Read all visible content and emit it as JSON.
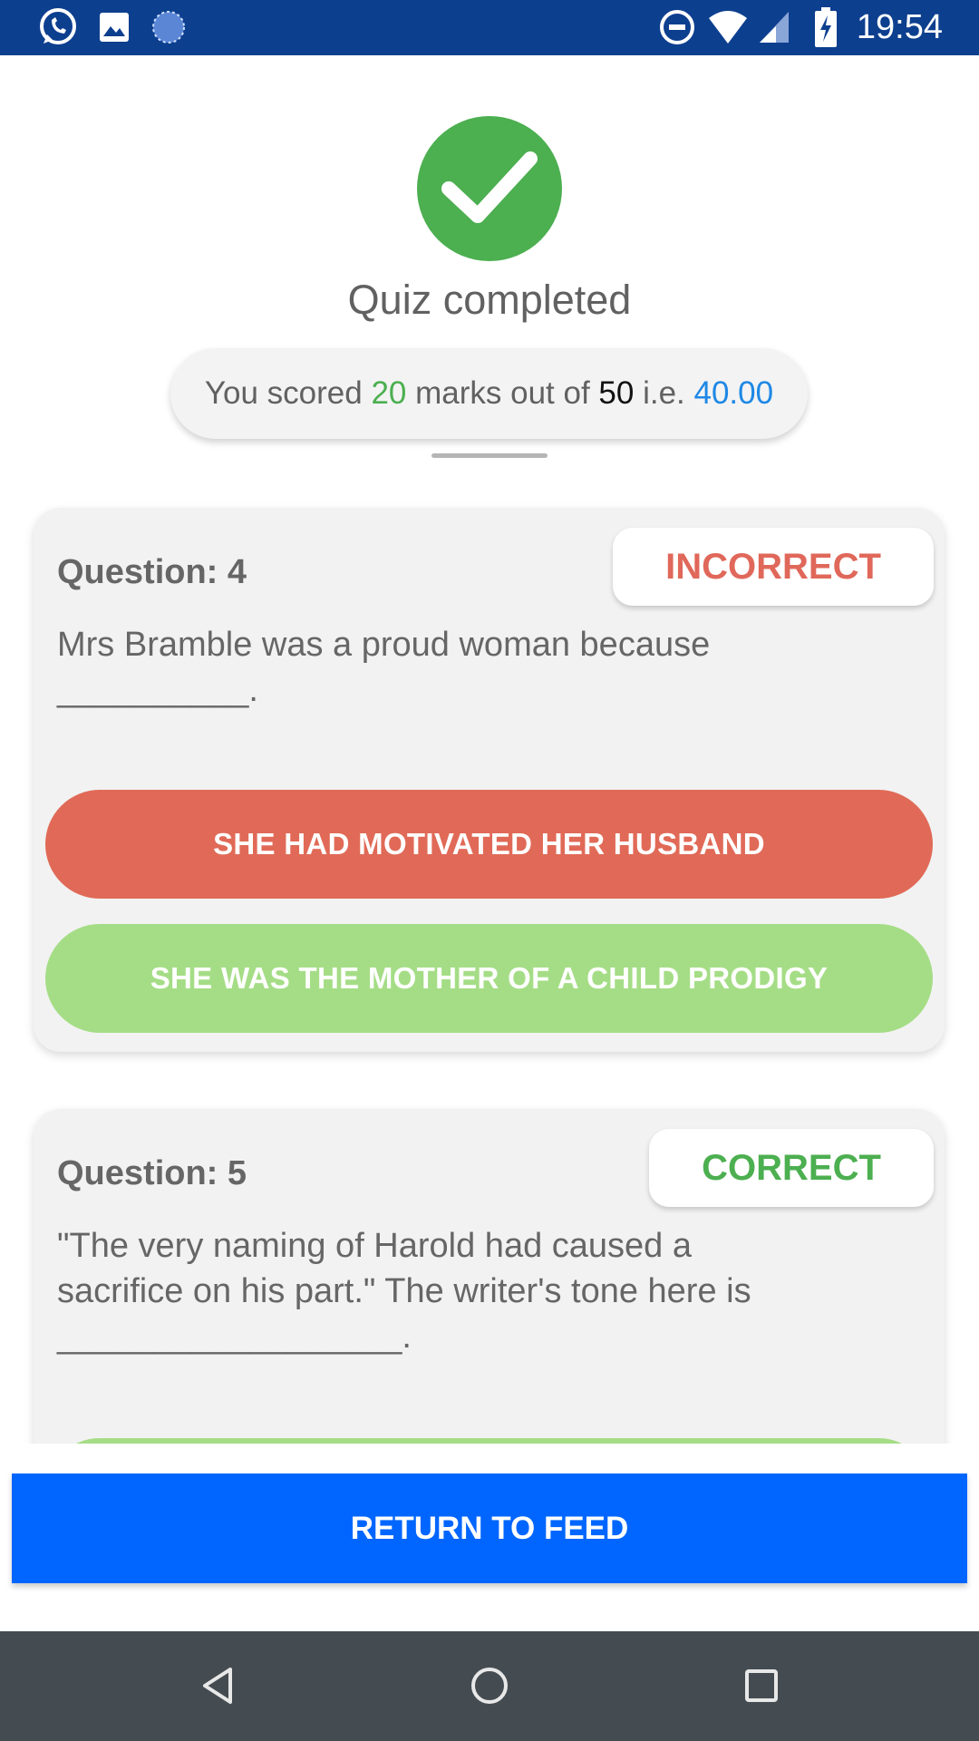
{
  "status_bar": {
    "time": "19:54",
    "left_icons": [
      "whatsapp-icon",
      "gallery-icon",
      "sync-icon"
    ],
    "right_icons": [
      "do-not-disturb-icon",
      "wifi-icon",
      "signal-icon",
      "battery-charging-icon"
    ]
  },
  "header": {
    "title": "Quiz completed",
    "score": {
      "prefix": "You scored ",
      "scored": "20",
      "middle": " marks out of ",
      "total": "50",
      "ie": " i.e. ",
      "percent": "40.00"
    }
  },
  "questions": [
    {
      "label": "Question: 4",
      "status": "INCORRECT",
      "text_line1": "Mrs Bramble was a proud woman because",
      "text_line2": "__________.",
      "answers": [
        {
          "label": "SHE HAD MOTIVATED HER HUSBAND",
          "state": "wrong"
        },
        {
          "label": "SHE WAS THE MOTHER OF A CHILD PRODIGY",
          "state": "right"
        }
      ]
    },
    {
      "label": "Question: 5",
      "status": "CORRECT",
      "text_line1": "\"The very naming of Harold had caused a",
      "text_line2": "sacrifice on his part.\" The writer's tone here is",
      "text_line3": "__________________."
    }
  ],
  "footer": {
    "return_label": "RETURN TO FEED"
  },
  "colors": {
    "status_bar": "#0d3f8f",
    "check": "#4caf50",
    "incorrect": "#e0685a",
    "correct": "#4caf50",
    "wrong_answer": "#e06a57",
    "right_answer": "#a5dd86",
    "return_button": "#0066ff",
    "nav_bar": "#454c51"
  }
}
